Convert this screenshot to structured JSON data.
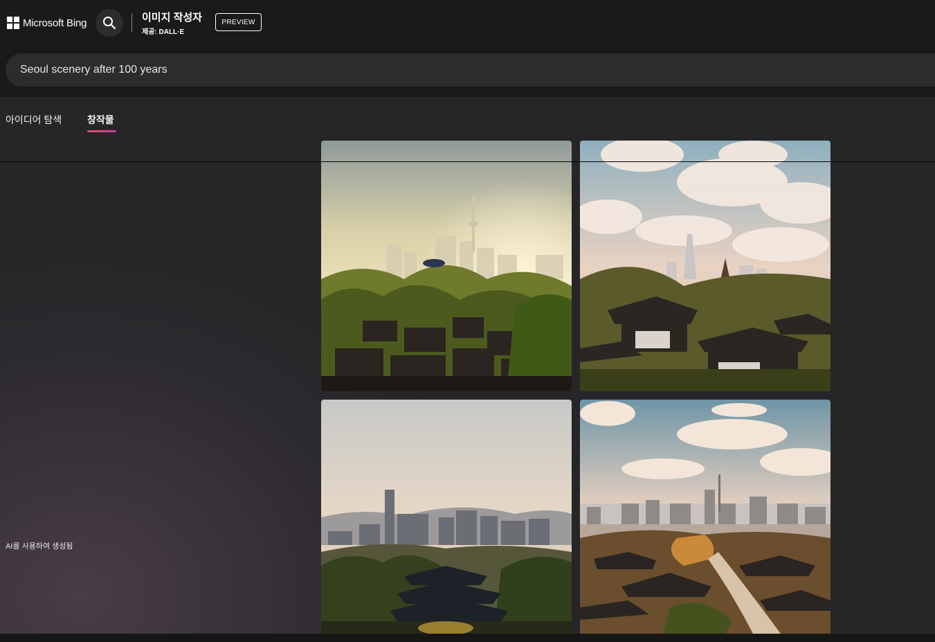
{
  "header": {
    "brand": "Microsoft Bing",
    "app_title": "이미지 작성자",
    "provider": "제공: DALL·E",
    "badge": "PREVIEW"
  },
  "prompt": {
    "value": "Seoul scenery after 100 years"
  },
  "tabs": [
    {
      "label": "아이디어 탐색",
      "active": false
    },
    {
      "label": "창작물",
      "active": true
    }
  ],
  "colors": {
    "tab_underline": "#e0506a",
    "page_bg": "#1b1a19"
  },
  "footer_note": "AI를 사용하여 생성됨"
}
